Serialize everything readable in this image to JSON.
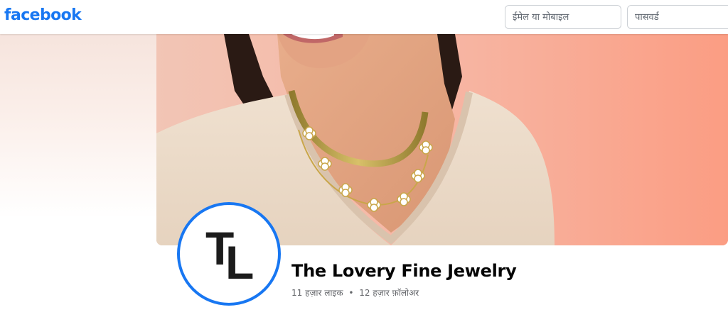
{
  "header": {
    "logo_text": "facebook",
    "email_placeholder": "ईमेल या मोबाइल",
    "password_placeholder": "पासवर्ड"
  },
  "profile": {
    "avatar_initial_1": "T",
    "avatar_initial_2": "L",
    "name": "The Lovery Fine Jewelry",
    "likes": "11 हज़ार लाइक",
    "separator": "•",
    "followers": "12 हज़ार फ़ॉलोअर"
  },
  "colors": {
    "brand_blue": "#1877f2",
    "cover_pink": "#f6b7a4",
    "text_primary": "#050505",
    "text_secondary": "#65676b"
  },
  "icons": [
    "facebook-logo",
    "tl-logo-avatar"
  ]
}
